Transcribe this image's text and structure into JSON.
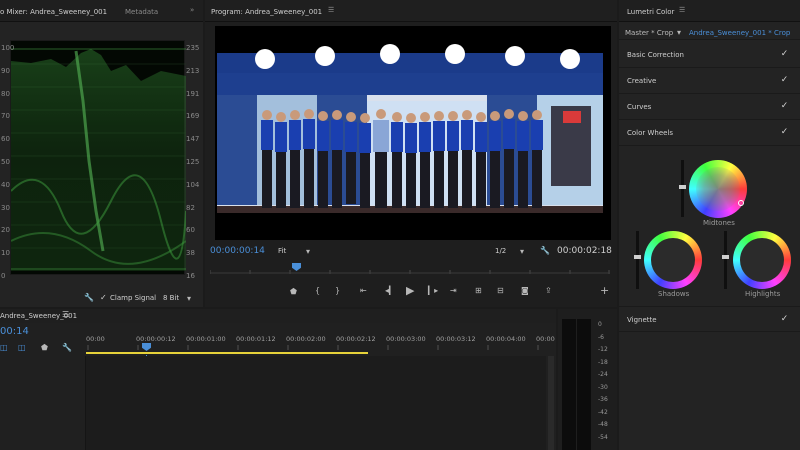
{
  "scopes": {
    "tab_mixer": "o Mixer: Andrea_Sweeney_001",
    "tab_metadata": "Metadata",
    "left_scale": [
      "100",
      "90",
      "80",
      "70",
      "60",
      "50",
      "40",
      "30",
      "20",
      "10",
      "0"
    ],
    "right_scale": [
      "235",
      "213",
      "191",
      "169",
      "147",
      "125",
      "104",
      "82",
      "60",
      "38",
      "16"
    ],
    "clamp_label": "Clamp Signal",
    "bit_depth": "8 Bit"
  },
  "program": {
    "title": "Program: Andrea_Sweeney_001",
    "timecode_current": "00:00:00:14",
    "fit_label": "Fit",
    "resolution": "1/2",
    "timecode_duration": "00:00:02:18",
    "controls": [
      "marker",
      "in",
      "out",
      "go-in",
      "step-back",
      "play",
      "step-forward",
      "go-out",
      "lift",
      "extract",
      "export-frame",
      "export",
      "add"
    ]
  },
  "lumetri": {
    "title": "Lumetri Color",
    "master_label": "Master * Crop",
    "clip_label": "Andrea_Sweeney_001 * Crop",
    "sections": [
      {
        "label": "Basic Correction"
      },
      {
        "label": "Creative"
      },
      {
        "label": "Curves"
      },
      {
        "label": "Color Wheels"
      }
    ],
    "wheels": {
      "midtones": "Midtones",
      "shadows": "Shadows",
      "highlights": "Highlights"
    },
    "vignette": "Vignette"
  },
  "timeline": {
    "tab": "Andrea_Sweeney_001",
    "timecode": "00:14",
    "ruler": [
      "00:00",
      "00:00:00:12",
      "00:00:01:00",
      "00:00:01:12",
      "00:00:02:00",
      "00:00:02:12",
      "00:00:03:00",
      "00:00:03:12",
      "00:00:04:00",
      "00:00"
    ]
  },
  "meter": {
    "scale": [
      "0",
      "-6",
      "-12",
      "-18",
      "-24",
      "-30",
      "-36",
      "-42",
      "-48",
      "-54"
    ]
  },
  "colors": {
    "accent_blue": "#4a8fd8",
    "timeline_yellow": "#e6d23a"
  }
}
